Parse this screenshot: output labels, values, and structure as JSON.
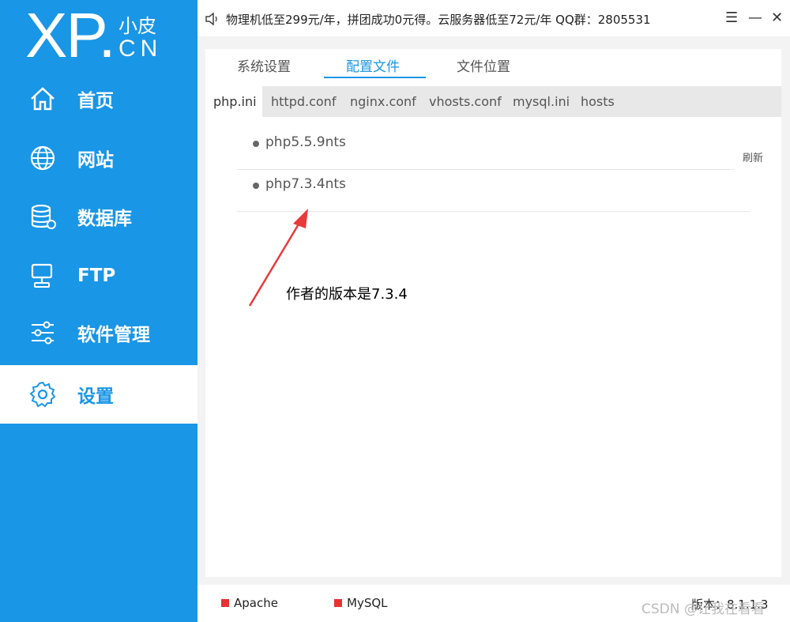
{
  "logo": {
    "xp": "XP.",
    "cn_top": "小皮",
    "cn_bottom": "CN"
  },
  "nav": [
    {
      "label": "首页"
    },
    {
      "label": "网站"
    },
    {
      "label": "数据库"
    },
    {
      "label": "FTP"
    },
    {
      "label": "软件管理"
    },
    {
      "label": "设置"
    }
  ],
  "header": {
    "notice": "物理机低至299元/年，拼团成功0元得。云服务器低至72元/年 QQ群：2805531",
    "menu_symbol": "☰",
    "minimize_symbol": "—",
    "close_symbol": "✕"
  },
  "tabs": [
    "系统设置",
    "配置文件",
    "文件位置"
  ],
  "subtabs": [
    "php.ini",
    "httpd.conf",
    "nginx.conf",
    "vhosts.conf",
    "mysql.ini",
    "hosts"
  ],
  "php_versions": [
    "php5.5.9nts",
    "php7.3.4nts"
  ],
  "refresh_label": "刷新",
  "annotation": "作者的版本是7.3.4",
  "footer": {
    "services": [
      "Apache",
      "MySQL"
    ],
    "version_label": "版本：8.1.1.3",
    "watermark": "CSDN @让我在看看"
  },
  "colors": {
    "accent": "#1996e6",
    "service_stopped": "#e63232",
    "annotation_arrow": "#e83a3a"
  }
}
